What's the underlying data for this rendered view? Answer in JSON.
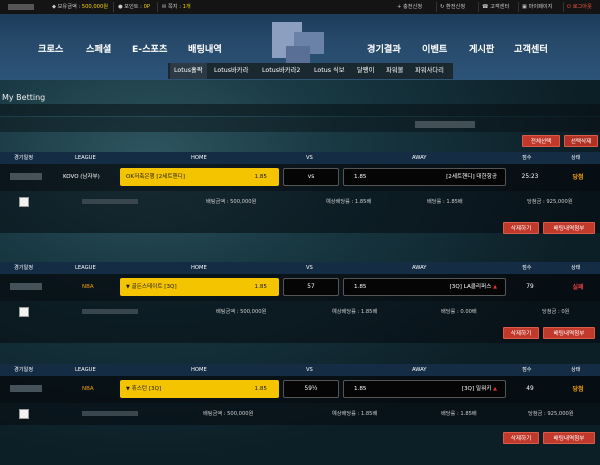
{
  "topbar": {
    "balance_label": "보유금액 : ",
    "balance_value": "500,000원",
    "point_label": "포인트 : ",
    "point_value": "0P",
    "message_label": "쪽지 : ",
    "message_value": "1개",
    "deposit": "+ 충전신청",
    "withdraw": "환전신청",
    "support": "고객센터",
    "mypage": "마이페이지",
    "logout": "로그아웃"
  },
  "nav": {
    "left": [
      "크로스",
      "스페셜",
      "E-스포츠",
      "배팅내역"
    ],
    "right": [
      "경기결과",
      "이벤트",
      "게시판",
      "고객센터"
    ]
  },
  "subnav": [
    "Lotus홀짝",
    "Lotus바카라",
    "Lotus바카라2",
    "Lotus 식보",
    "달팽이",
    "파워볼",
    "파워사다리"
  ],
  "page_title": "My Betting",
  "actions": {
    "select_all": "전체선택",
    "delete_selected": "선택삭제"
  },
  "columns": [
    "경기일정",
    "LEAGUE",
    "HOME",
    "VS",
    "AWAY",
    "점수",
    "상태"
  ],
  "bets": [
    {
      "league": "KOVO (남자부)",
      "home": "OK저축은행 [2세트핸디]",
      "home_odds": "1.85",
      "vs": "vs",
      "away_odds": "1.85",
      "away": "[2세트핸디] 대한항공",
      "score": "25:23",
      "status": "당첨",
      "bet_amount": "배팅금액 : 500,000원",
      "expected_odds": "예상배당률 : 1.85배",
      "odds": "배당률 : 1.85배",
      "win_amount": "당첨금 : 925,000원",
      "delete": "삭제하기",
      "detail": "배팅내역첨부"
    },
    {
      "league": "NBA",
      "home": "골든스테이트 [3Q]",
      "home_odds": "1.85",
      "vs": "57",
      "away_odds": "1.85",
      "away": "[3Q] LA클리퍼스",
      "score": "79",
      "status": "실패",
      "bet_amount": "배팅금액 : 500,000원",
      "expected_odds": "예상배당률 : 1.85배",
      "odds": "배당률 : 0.00배",
      "win_amount": "당첨금 : 0원",
      "delete": "삭제하기",
      "detail": "배팅내역첨부"
    },
    {
      "league": "NBA",
      "home": "휴스턴 [3Q]",
      "home_odds": "1.85",
      "vs": "59½",
      "away_odds": "1.85",
      "away": "[3Q] 밀워키",
      "score": "49",
      "status": "당첨",
      "bet_amount": "배팅금액 : 500,000원",
      "expected_odds": "예상배당률 : 1.85배",
      "odds": "배당률 : 1.85배",
      "win_amount": "당첨금 : 925,000원",
      "delete": "삭제하기",
      "detail": "배팅내역첨부"
    }
  ],
  "colors": {
    "accent": "#f5c400",
    "win": "#f0a000",
    "lose": "#e04040",
    "button": "#c0392b"
  },
  "icons": [
    "diamond-icon",
    "coin-icon",
    "mail-icon",
    "plus-icon",
    "refresh-icon",
    "headset-icon",
    "user-icon",
    "power-icon",
    "up-triangle-icon",
    "down-triangle-icon"
  ]
}
